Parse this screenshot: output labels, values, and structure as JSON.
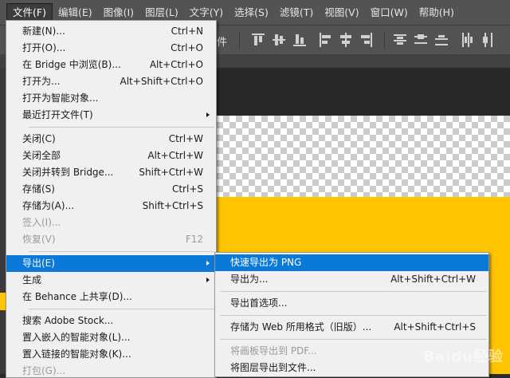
{
  "menubar": {
    "items": [
      {
        "label": "文件(F)",
        "active": true
      },
      {
        "label": "编辑(E)"
      },
      {
        "label": "图像(I)"
      },
      {
        "label": "图层(L)"
      },
      {
        "label": "文字(Y)"
      },
      {
        "label": "选择(S)"
      },
      {
        "label": "滤镜(T)"
      },
      {
        "label": "视图(V)"
      },
      {
        "label": "窗口(W)"
      },
      {
        "label": "帮助(H)"
      }
    ]
  },
  "options_bar": {
    "fragment": "件"
  },
  "file_menu": {
    "new": {
      "label": "新建(N)...",
      "shortcut": "Ctrl+N"
    },
    "open": {
      "label": "打开(O)...",
      "shortcut": "Ctrl+O"
    },
    "bridge": {
      "label": "在 Bridge 中浏览(B)...",
      "shortcut": "Alt+Ctrl+O"
    },
    "open_as": {
      "label": "打开为...",
      "shortcut": "Alt+Shift+Ctrl+O"
    },
    "open_smart": {
      "label": "打开为智能对象..."
    },
    "recent": {
      "label": "最近打开文件(T)"
    },
    "close": {
      "label": "关闭(C)",
      "shortcut": "Ctrl+W"
    },
    "close_all": {
      "label": "关闭全部",
      "shortcut": "Alt+Ctrl+W"
    },
    "close_bridge": {
      "label": "关闭并转到 Bridge...",
      "shortcut": "Shift+Ctrl+W"
    },
    "save": {
      "label": "存储(S)",
      "shortcut": "Ctrl+S"
    },
    "save_as": {
      "label": "存储为(A)...",
      "shortcut": "Shift+Ctrl+S"
    },
    "checkin": {
      "label": "签入(I)..."
    },
    "revert": {
      "label": "恢复(V)",
      "shortcut": "F12"
    },
    "export": {
      "label": "导出(E)"
    },
    "generate": {
      "label": "生成"
    },
    "behance": {
      "label": "在 Behance 上共享(D)..."
    },
    "stock": {
      "label": "搜索 Adobe Stock..."
    },
    "place_embedded": {
      "label": "置入嵌入的智能对象(L)..."
    },
    "place_linked": {
      "label": "置入链接的智能对象(K)..."
    },
    "package": {
      "label": "打包(G)..."
    }
  },
  "export_menu": {
    "quick_png": {
      "label": "快速导出为 PNG"
    },
    "export_as": {
      "label": "导出为...",
      "shortcut": "Alt+Shift+Ctrl+W"
    },
    "prefs": {
      "label": "导出首选项..."
    },
    "save_web": {
      "label": "存储为 Web 所用格式（旧版）...",
      "shortcut": "Alt+Shift+Ctrl+S"
    },
    "artboards_pdf": {
      "label": "将画板导出到 PDF..."
    },
    "layers_files": {
      "label": "将图层导出到文件..."
    }
  },
  "watermark": "Baidu经验",
  "colors": {
    "canvas_yellow": "#ffc400",
    "highlight": "#0a79d8",
    "menubar": "#535353"
  }
}
